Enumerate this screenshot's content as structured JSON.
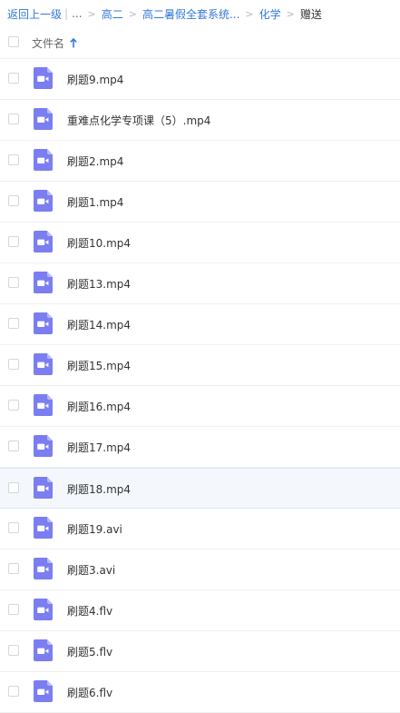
{
  "breadcrumb": {
    "back": "返回上一级",
    "pipe": "|",
    "ellipsis": "...",
    "sep": ">",
    "items": [
      "高二",
      "高二暑假全套系统...",
      "化学"
    ],
    "current": "赠送"
  },
  "list_header": {
    "name_label": "文件名",
    "sort_icon": "arrow-up-icon"
  },
  "colors": {
    "link": "#3478d7",
    "video_icon": "#7b7ef0",
    "selected_row": "#f4f8fd"
  },
  "files": [
    {
      "name": "刷题9.mp4"
    },
    {
      "name": "重难点化学专项课（5）.mp4"
    },
    {
      "name": "刷题2.mp4"
    },
    {
      "name": "刷题1.mp4"
    },
    {
      "name": "刷题10.mp4"
    },
    {
      "name": "刷题13.mp4"
    },
    {
      "name": "刷题14.mp4"
    },
    {
      "name": "刷题15.mp4"
    },
    {
      "name": "刷题16.mp4"
    },
    {
      "name": "刷题17.mp4"
    },
    {
      "name": "刷题18.mp4",
      "hovered": true
    },
    {
      "name": "刷题19.avi"
    },
    {
      "name": "刷题3.avi"
    },
    {
      "name": "刷题4.flv"
    },
    {
      "name": "刷题5.flv"
    },
    {
      "name": "刷题6.flv"
    }
  ]
}
